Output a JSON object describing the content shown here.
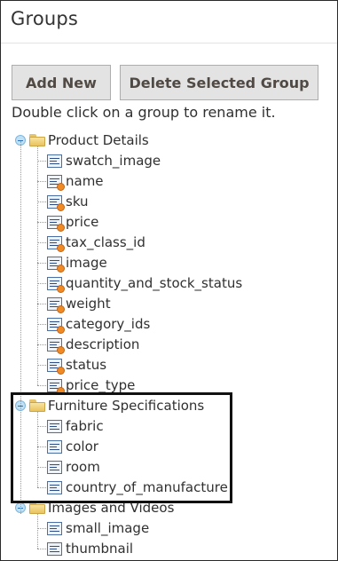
{
  "panel": {
    "title": "Groups"
  },
  "toolbar": {
    "add_label": "Add New",
    "delete_label": "Delete Selected Group"
  },
  "hint": "Double click on a group to rename it.",
  "tree": {
    "groups": [
      {
        "label": "Product Details",
        "items": [
          {
            "label": "swatch_image",
            "user_defined": false
          },
          {
            "label": "name",
            "user_defined": true
          },
          {
            "label": "sku",
            "user_defined": true
          },
          {
            "label": "price",
            "user_defined": true
          },
          {
            "label": "tax_class_id",
            "user_defined": true
          },
          {
            "label": "image",
            "user_defined": true
          },
          {
            "label": "quantity_and_stock_status",
            "user_defined": true
          },
          {
            "label": "weight",
            "user_defined": true
          },
          {
            "label": "category_ids",
            "user_defined": true
          },
          {
            "label": "description",
            "user_defined": true
          },
          {
            "label": "status",
            "user_defined": true
          },
          {
            "label": "price_type",
            "user_defined": true
          }
        ]
      },
      {
        "label": "Furniture Specifications",
        "items": [
          {
            "label": "fabric",
            "user_defined": false
          },
          {
            "label": "color",
            "user_defined": false
          },
          {
            "label": "room",
            "user_defined": false
          },
          {
            "label": "country_of_manufacture",
            "user_defined": false
          }
        ]
      },
      {
        "label": "Images and Videos",
        "items": [
          {
            "label": "small_image",
            "user_defined": false
          },
          {
            "label": "thumbnail",
            "user_defined": false
          }
        ]
      }
    ]
  },
  "colors": {
    "button_bg": "#e3e3e3",
    "text": "#303030",
    "highlight_border": "#111111"
  }
}
